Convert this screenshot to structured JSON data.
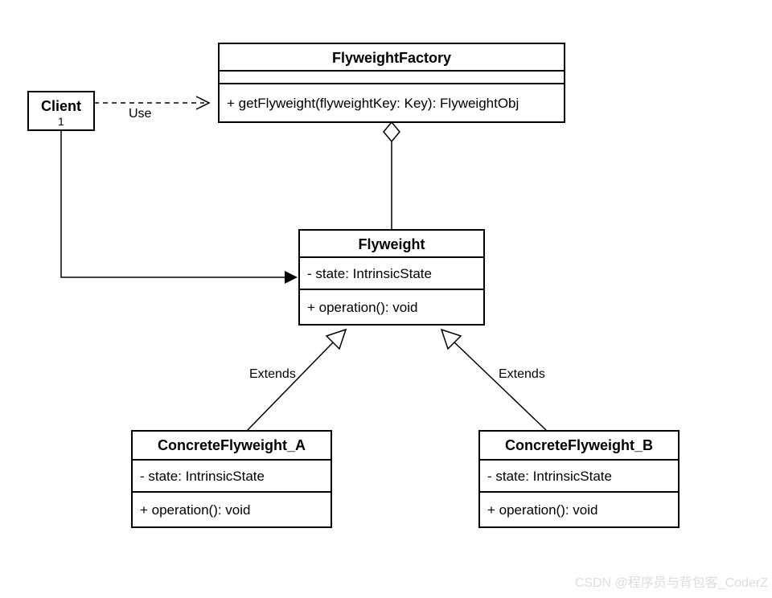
{
  "classes": {
    "factory": {
      "name": "FlyweightFactory",
      "methods": [
        "+ getFlyweight(flyweightKey: Key): FlyweightObj"
      ]
    },
    "client": {
      "name": "Client",
      "mult": "1"
    },
    "flyweight": {
      "name": "Flyweight",
      "attrs": [
        "- state: IntrinsicState"
      ],
      "methods": [
        "+ operation(): void"
      ]
    },
    "concreteA": {
      "name": "ConcreteFlyweight_A",
      "attrs": [
        "- state: IntrinsicState"
      ],
      "methods": [
        "+ operation(): void"
      ]
    },
    "concreteB": {
      "name": "ConcreteFlyweight_B",
      "attrs": [
        "- state: IntrinsicState"
      ],
      "methods": [
        "+ operation(): void"
      ]
    }
  },
  "edges": {
    "use": "Use",
    "extendsA": "Extends",
    "extendsB": "Extends"
  },
  "watermark": "CSDN @程序员与背包客_CoderZ"
}
